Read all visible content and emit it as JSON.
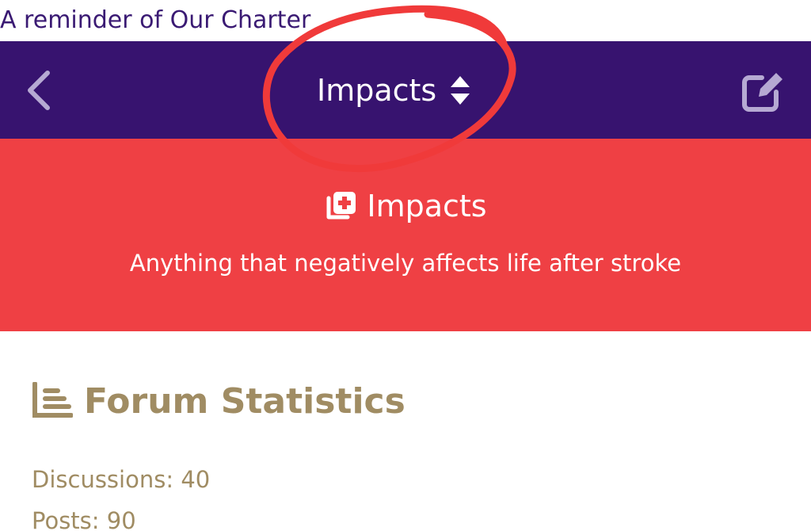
{
  "top_link": {
    "text": "A reminder of Our Charter"
  },
  "navbar": {
    "background": "#37136f",
    "back_icon": "chevron-left-icon",
    "title": "Impacts",
    "title_icon": "sort-updown-icon",
    "edit_icon": "edit-square-icon"
  },
  "annotation": {
    "type": "hand-drawn-circle",
    "color": "#f03a3a"
  },
  "hero": {
    "background": "#ef4044",
    "icon": "medical-plus-icon",
    "title": "Impacts",
    "description": "Anything that negatively affects life after stroke"
  },
  "stats": {
    "icon": "list-stats-icon",
    "title": "Forum Statistics",
    "color": "#a08c63",
    "discussions": "Discussions: 40",
    "posts": "Posts: 90"
  }
}
